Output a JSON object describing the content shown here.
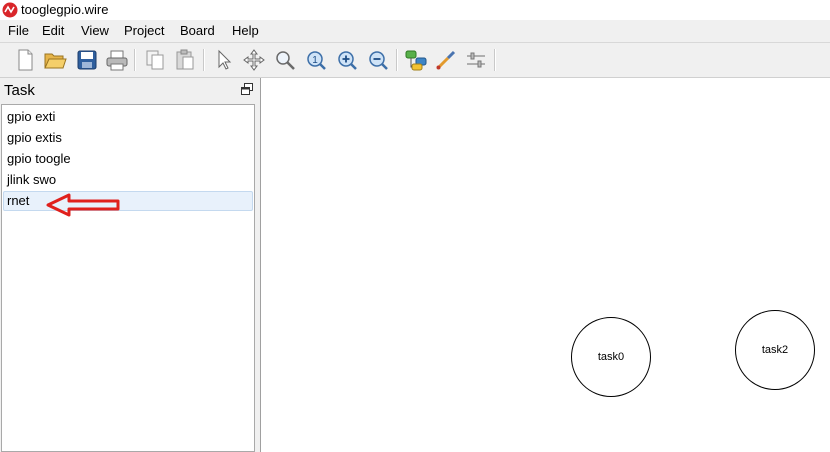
{
  "window": {
    "title": "tooglegpio.wire"
  },
  "menu": [
    "File",
    "Edit",
    "View",
    "Project",
    "Board",
    "Help"
  ],
  "toolbar": {
    "icons": [
      "new-file-icon",
      "open-folder-icon",
      "save-icon",
      "print-icon",
      "copy-icon",
      "paste-icon",
      "select-pointer-icon",
      "move-icon",
      "search-icon",
      "zoom-reset-icon",
      "zoom-in-icon",
      "zoom-out-icon",
      "add-component-icon",
      "wire-tool-icon",
      "settings-sliders-icon"
    ]
  },
  "panel": {
    "title": "Task",
    "items": [
      "gpio exti",
      "gpio extis",
      "gpio toogle",
      "jlink swo",
      "rnet"
    ],
    "selected_index": 4
  },
  "canvas": {
    "nodes": [
      {
        "label": "task0"
      },
      {
        "label": "task2"
      }
    ]
  },
  "colors": {
    "annotation_arrow": "#e0201c",
    "selection": "#e8f1fb"
  }
}
